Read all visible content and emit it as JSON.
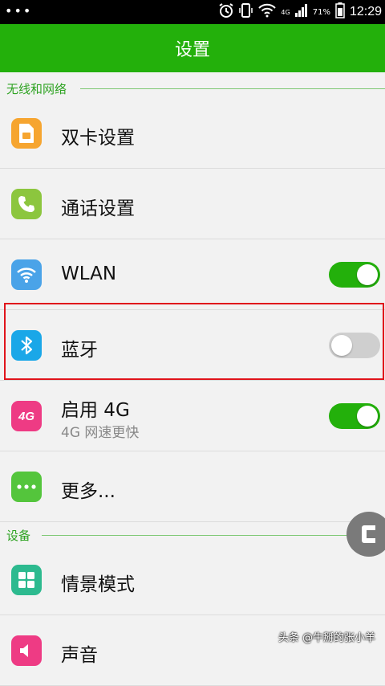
{
  "status_bar": {
    "dots": "•••",
    "network_label": "4G",
    "battery_percent": "71%",
    "time": "12:29"
  },
  "app_bar": {
    "title": "设置"
  },
  "sections": {
    "wireless": {
      "title": "无线和网络"
    },
    "device": {
      "title": "设备"
    }
  },
  "rows": [
    {
      "label": "双卡设置",
      "icon": "sim-card-icon",
      "color": "#f6a530"
    },
    {
      "label": "通话设置",
      "icon": "phone-icon",
      "color": "#8cc63e"
    },
    {
      "label": "WLAN",
      "icon": "wifi-icon",
      "color": "#4aa3e8",
      "toggle": "on"
    },
    {
      "label": "蓝牙",
      "icon": "bluetooth-icon",
      "color": "#1aa7e8",
      "toggle": "off"
    },
    {
      "label": "启用 4G",
      "sublabel": "4G 网速更快",
      "icon_text": "4G",
      "icon": "4g-icon",
      "color": "#ee3b84",
      "toggle": "on"
    },
    {
      "label": "更多...",
      "icon": "more-icon",
      "color": "#54c53c"
    },
    {
      "label": "情景模式",
      "icon": "scene-mode-icon",
      "color": "#2dba8f"
    },
    {
      "label": "声音",
      "icon": "sound-icon",
      "color": "#ee3b84"
    }
  ],
  "watermark": "头条 @牛掰的张小羊",
  "colors": {
    "accent": "#23b00b",
    "highlight_border": "#e0141c"
  }
}
